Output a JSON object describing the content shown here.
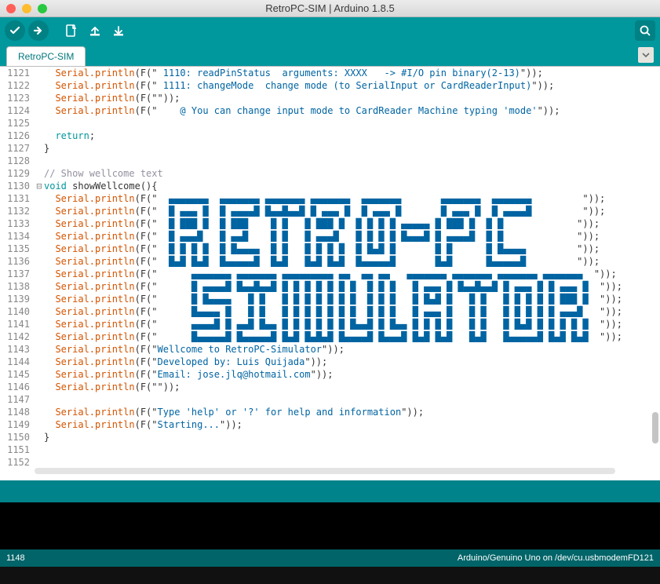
{
  "window": {
    "title": "RetroPC-SIM | Arduino 1.8.5"
  },
  "tab": {
    "label": "RetroPC-SIM"
  },
  "status": {
    "line": "1148",
    "board": "Arduino/Genuino Uno on /dev/cu.usbmodemFD121"
  },
  "code": {
    "first_line": 1121,
    "tokens": {
      "serial_println": "Serial.println",
      "F_open": "(F(\"",
      "F_close": "\"));",
      "return": "return",
      "void": "void",
      "show_fn": " showWellcome(){",
      "brace_close": "}",
      "empty_F": "(F(\"\"));",
      "comment_wellcome": "// Show wellcome text"
    },
    "lines": [
      {
        "t": "sp",
        "s": " 1110: readPinStatus  arguments: XXXX   -> #I/O pin binary(2-13)"
      },
      {
        "t": "sp",
        "s": " 1111: changeMode  change mode (to SerialInput or CardReaderInput)"
      },
      {
        "t": "spE"
      },
      {
        "t": "sp",
        "s": "    @ You can change input mode to CardReader Machine typing 'mode'"
      },
      {
        "t": "blank"
      },
      {
        "t": "ret"
      },
      {
        "t": "close"
      },
      {
        "t": "blank"
      },
      {
        "t": "com"
      },
      {
        "t": "fn"
      },
      {
        "t": "sp",
        "s": "  ▄▄▄▄▄▄▄  ▄▄▄▄▄▄▄ ▄▄▄▄▄▄▄ ▄▄▄▄▄▄▄  ▄▄▄▄▄▄▄       ▄▄▄▄▄▄▄  ▄▄▄▄▄▄▄         "
      },
      {
        "t": "sp",
        "s": "  █ ▄▄▄ █  █ ▄▄▄▄█ █▄▄█▄▄█ █ ▄▄▄ █  █ ▄▄▄ █       █ ▄▄▄ █  █ ▄▄▄▄█         "
      },
      {
        "t": "sp",
        "s": "  █ ███ █  █ ███    █ █   █ ███ █  █ █ █ █ ▄▄▄▄▄ █ ███ █  █ █             "
      },
      {
        "t": "sp",
        "s": "  █ ▄▄▄█   █ ▄▄█    █ █   █ ▄▄▄█   █ █ █ █ █▄▄▄█ █ ▄▄▄▄█  █ █             "
      },
      {
        "t": "sp",
        "s": "  █ █ █ █  █ █▄▄▄▄  █ █   █ █ █ █  █ █▄█ █       █ █      █ █▄▄▄▄         "
      },
      {
        "t": "sp",
        "s": "  █▄█ █▄█  █▄▄▄▄▄█  █▄█   █▄█ █▄█  █▄▄▄▄▄█       █▄█      █▄▄▄▄▄█         "
      },
      {
        "t": "sp",
        "s": "      ▄▄▄▄▄▄▄ ▄▄▄▄▄▄▄ ▄▄▄▄▄▄▄▄▄ ▄▄  ▄▄ ▄▄   ▄▄▄▄▄▄▄ ▄▄▄▄▄▄▄ ▄▄▄▄▄▄▄ ▄▄▄▄▄▄▄  "
      },
      {
        "t": "sp",
        "s": "      █ ▄▄▄▄█ █▄▄█▄▄█ █ █ █ █ █ █ █  █ █ █   █ ▄▄▄ █ █▄▄█▄▄█ █ ▄▄▄ █ █ ▄▄▄ █  "
      },
      {
        "t": "sp",
        "s": "      █ █▄▄▄▄   █ █   █ █ █ █ █ █ █  █ █ █   █ █▄█ █   █ █   █ █ █ █ █ ███ █  "
      },
      {
        "t": "sp",
        "s": "      █▄▄▄▄ █   █ █   █ █ █ █ █ █ █  █ █ █   █ ▄▄▄ █   █ █   █ █ █ █ █ ▄▄▄█   "
      },
      {
        "t": "sp",
        "s": "      ▄▄▄▄█ █ ▄▄█ █▄▄ █ █ █ █ █ █ █▄▄█ █ █▄▄ █ █ █ █   █ █   █ █▄█ █ █ █ █ █  "
      },
      {
        "t": "sp",
        "s": "      █▄▄▄▄▄█ █▄▄▄▄▄█ █▄█ █▄█▄█ █▄▄▄▄█ █▄▄▄█ █▄█ █▄█   █▄█   █▄▄▄▄▄█ █▄█ █▄█  "
      },
      {
        "t": "sp",
        "s": "Wellcome to RetroPC-Simulator"
      },
      {
        "t": "sp",
        "s": "Developed by: Luis Quijada"
      },
      {
        "t": "sp",
        "s": "Email: jose.jlq@hotmail.com"
      },
      {
        "t": "spE"
      },
      {
        "t": "blank"
      },
      {
        "t": "sp",
        "s": "Type 'help' or '?' for help and information"
      },
      {
        "t": "sp",
        "s": "Starting..."
      },
      {
        "t": "close"
      },
      {
        "t": "blank"
      },
      {
        "t": "blank"
      }
    ]
  }
}
